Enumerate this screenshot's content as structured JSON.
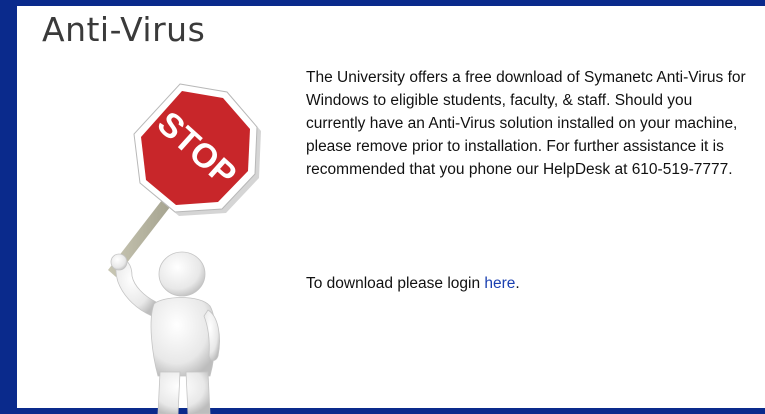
{
  "header": {
    "title": "Anti-Virus"
  },
  "illustration": {
    "sign_text": "STOP",
    "sign_color": "#c8262a"
  },
  "content": {
    "paragraph": "The University offers a free download of Symanetc Anti-Virus for Windows to eligible students, faculty, & staff.  Should you currently have an Anti-Virus solution installed on your machine, please remove prior to installation.  For further assistance it is recommended that you phone our HelpDesk at 610-519-7777.",
    "download_prefix": "To download please login ",
    "download_link": "here",
    "download_suffix": "."
  },
  "colors": {
    "frame": "#0a2a8c",
    "link": "#1a3fb0"
  }
}
